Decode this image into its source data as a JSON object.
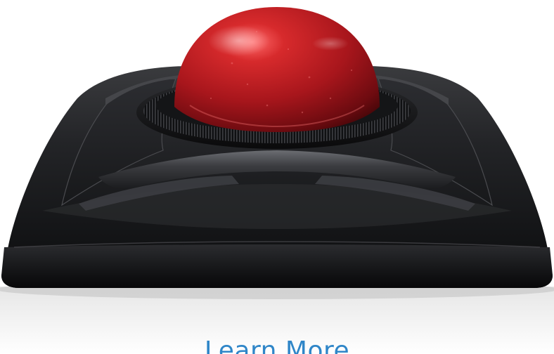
{
  "product": {
    "image_name": "trackball-product-photo",
    "ball_color": "#a8161c",
    "body_color": "#1e1f21",
    "ring_color": "#111214"
  },
  "cta": {
    "label": "Learn More",
    "color": "#2f86c8"
  }
}
